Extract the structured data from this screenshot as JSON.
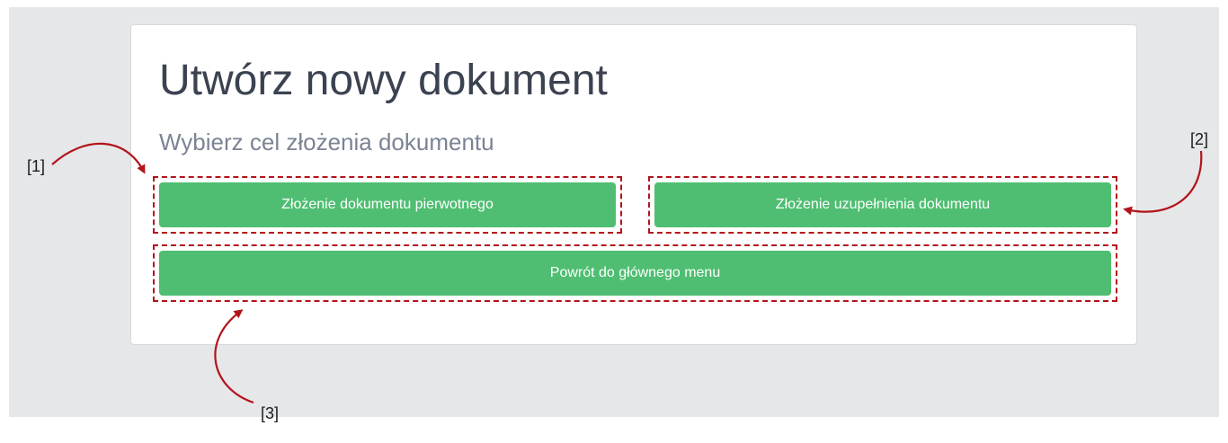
{
  "page": {
    "title": "Utwórz nowy dokument",
    "subtitle": "Wybierz cel złożenia dokumentu"
  },
  "buttons": {
    "primary_document": "Złożenie dokumentu pierwotnego",
    "supplement_document": "Złożenie uzupełnienia dokumentu",
    "back_to_menu": "Powrót do głównego menu"
  },
  "callouts": {
    "label_1": "[1]",
    "label_2": "[2]",
    "label_3": "[3]"
  },
  "colors": {
    "button_green": "#4fbe72",
    "annotation_red": "#b3141b",
    "background_gray": "#e6e7e9"
  }
}
